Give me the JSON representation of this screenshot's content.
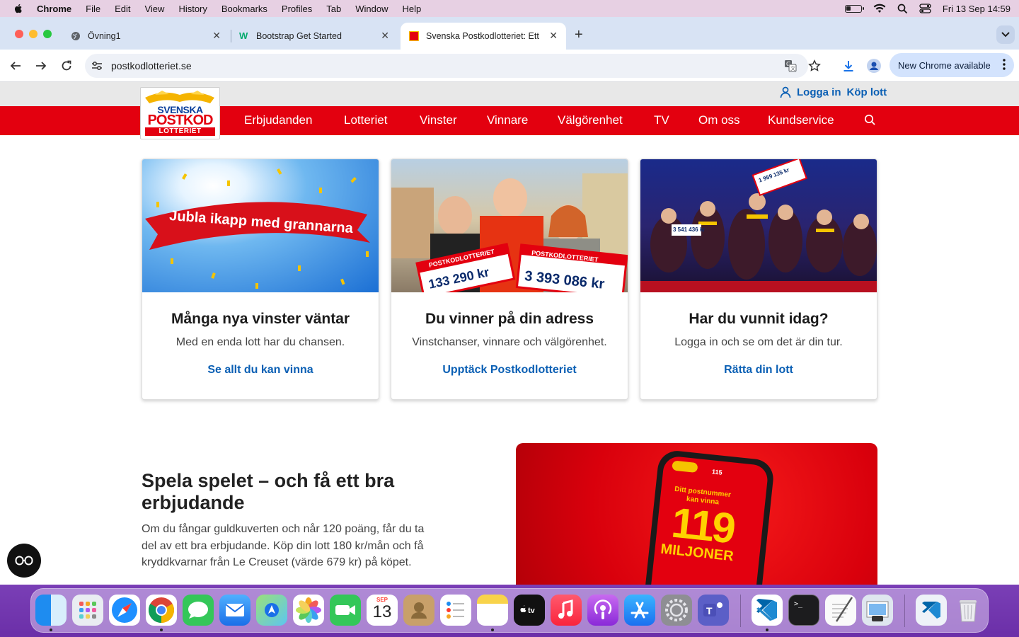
{
  "menubar": {
    "app": "Chrome",
    "items": [
      "File",
      "Edit",
      "View",
      "History",
      "Bookmarks",
      "Profiles",
      "Tab",
      "Window",
      "Help"
    ],
    "clock": "Fri 13 Sep  14:59"
  },
  "tabs": [
    {
      "title": "Övning1",
      "icon": "globe-icon"
    },
    {
      "title": "Bootstrap Get Started",
      "icon": "w3schools-icon"
    },
    {
      "title": "Svenska Postkodlotteriet: Ett",
      "icon": "postkod-favicon"
    }
  ],
  "toolbar": {
    "url": "postkodlotteriet.se",
    "update_button": "New Chrome available"
  },
  "site": {
    "account": {
      "login": "Logga in",
      "buy": "Köp lott"
    },
    "logo": {
      "line1": "SVENSKA",
      "line2": "POSTKOD",
      "line3": "LOTTERIET"
    },
    "nav": [
      "Erbjudanden",
      "Lotteriet",
      "Vinster",
      "Vinnare",
      "Välgörenhet",
      "TV",
      "Om oss",
      "Kundservice"
    ],
    "cards": [
      {
        "banner": "Jubla ikapp med grannarna",
        "title": "Många nya vinster väntar",
        "desc": "Med en enda lott har du chansen.",
        "link": "Se allt du kan vinna"
      },
      {
        "check1": "POSTKODLOTTERIET",
        "amount1": "133 290 kr",
        "check2": "POSTKODLOTTERIET",
        "amount2": "3 393 086 kr",
        "title": "Du vinner på din adress",
        "desc": "Vinstchanser, vinnare och välgörenhet.",
        "link": "Upptäck Postkodlotteriet"
      },
      {
        "sign1": "3 541 436 kr",
        "sign2": "1 959 135 kr",
        "title": "Har du vunnit idag?",
        "desc": "Logga in och se om det är din tur.",
        "link": "Rätta din lott"
      }
    ],
    "promo": {
      "heading": "Spela spelet – och få ett bra erbjudande",
      "text": "Om du fångar guldkuverten och når 120 poäng, får du ta del av ett bra erbjudande. Köp din lott 180 kr/mån och få kryddkvarnar från Le Creuset (värde 679 kr) på köpet.",
      "phone_score": "115",
      "phone_line1": "Ditt postnummer",
      "phone_line2": "kan vinna",
      "phone_number": "119",
      "phone_unit": "MILJONER"
    }
  },
  "dock": {
    "calendar_month": "SEP",
    "calendar_day": "13",
    "apps": [
      "finder-icon",
      "launchpad-icon",
      "safari-icon",
      "chrome-icon",
      "messages-icon",
      "mail-icon",
      "maps-icon",
      "photos-icon",
      "facetime-icon",
      "calendar-icon",
      "contacts-icon",
      "reminders-icon",
      "notes-icon",
      "appletv-icon",
      "music-icon",
      "podcasts-icon",
      "appstore-icon",
      "settings-icon",
      "teams-icon",
      "vscode-icon",
      "terminal-icon",
      "textedit-icon",
      "preview-icon",
      "vscode-download-icon",
      "trash-icon"
    ]
  },
  "colors": {
    "brand_red": "#e3000f",
    "link_blue": "#0a5fb4",
    "logo_blue": "#0a3f9c"
  }
}
